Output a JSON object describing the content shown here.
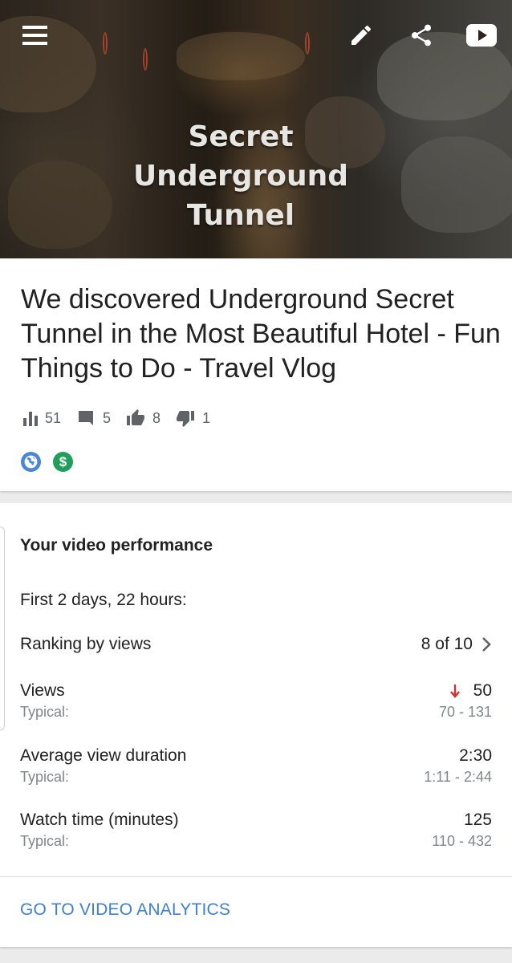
{
  "header": {
    "menu_icon": "menu-icon",
    "edit_icon": "edit-pencil-icon",
    "share_icon": "share-icon",
    "youtube_icon": "youtube-icon"
  },
  "thumbnail": {
    "title_lines": [
      "Secret",
      "Underground",
      "Tunnel"
    ]
  },
  "video": {
    "title": "We discovered Underground Secret Tunnel in the Most Beautiful Hotel - Fun Things to Do - Travel Vlog",
    "stats": {
      "views": "51",
      "comments": "5",
      "likes": "8",
      "dislikes": "1"
    },
    "badges": [
      "globe-icon",
      "monetization-dollar-icon"
    ]
  },
  "performance": {
    "heading": "Your video performance",
    "period": "First 2 days, 22 hours:",
    "ranking_label": "Ranking by views",
    "ranking_value": "8 of 10",
    "rows": [
      {
        "label": "Views",
        "typical_label": "Typical:",
        "value": "50",
        "range": "70 - 131",
        "trend": "down"
      },
      {
        "label": "Average view duration",
        "typical_label": "Typical:",
        "value": "2:30",
        "range": "1:11 - 2:44"
      },
      {
        "label": "Watch time (minutes)",
        "typical_label": "Typical:",
        "value": "125",
        "range": "110 - 432"
      }
    ],
    "link": "GO TO VIDEO ANALYTICS"
  },
  "colors": {
    "link": "#3d7fd0",
    "trend_down": "#d32f2f",
    "globe_badge": "#4a86d6",
    "money_badge": "#1f9f5a"
  }
}
